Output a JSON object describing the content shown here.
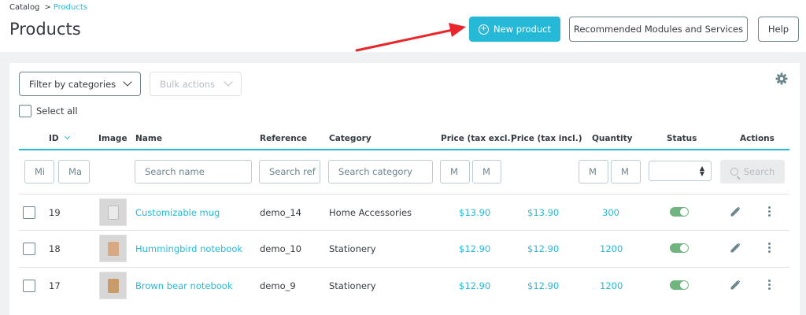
{
  "header": {
    "breadcrumb": {
      "parent": "Catalog",
      "separator": ">",
      "current": "Products"
    },
    "title": "Products",
    "new_product_label": "New product",
    "recommended_label": "Recommended Modules and Services",
    "help_label": "Help"
  },
  "toolbar": {
    "filter_by_categories": "Filter by categories",
    "bulk_actions": "Bulk actions",
    "select_all": "Select all"
  },
  "columns": {
    "id": "ID",
    "image": "Image",
    "name": "Name",
    "reference": "Reference",
    "category": "Category",
    "price_excl": "Price (tax excl.)",
    "price_incl": "Price (tax incl.)",
    "quantity": "Quantity",
    "status": "Status",
    "actions": "Actions"
  },
  "filters": {
    "id_min": "Mi",
    "id_max": "Ma",
    "name_placeholder": "Search name",
    "ref_placeholder": "Search ref",
    "category_placeholder": "Search category",
    "price_min": "M",
    "price_max": "M",
    "qty_min": "M",
    "qty_max": "M",
    "search_label": "Search"
  },
  "rows": [
    {
      "id": "19",
      "name": "Customizable mug",
      "reference": "demo_14",
      "category": "Home Accessories",
      "price_excl": "$13.90",
      "price_incl": "$13.90",
      "quantity": "300",
      "status": "enabled"
    },
    {
      "id": "18",
      "name": "Hummingbird notebook",
      "reference": "demo_10",
      "category": "Stationery",
      "price_excl": "$12.90",
      "price_incl": "$12.90",
      "quantity": "1200",
      "status": "enabled"
    },
    {
      "id": "17",
      "name": "Brown bear notebook",
      "reference": "demo_9",
      "category": "Stationery",
      "price_excl": "$12.90",
      "price_incl": "$12.90",
      "quantity": "1200",
      "status": "enabled"
    }
  ],
  "colors": {
    "accent": "#25b9d7",
    "toggle_on": "#70b580",
    "arrow": "#e8262b"
  }
}
